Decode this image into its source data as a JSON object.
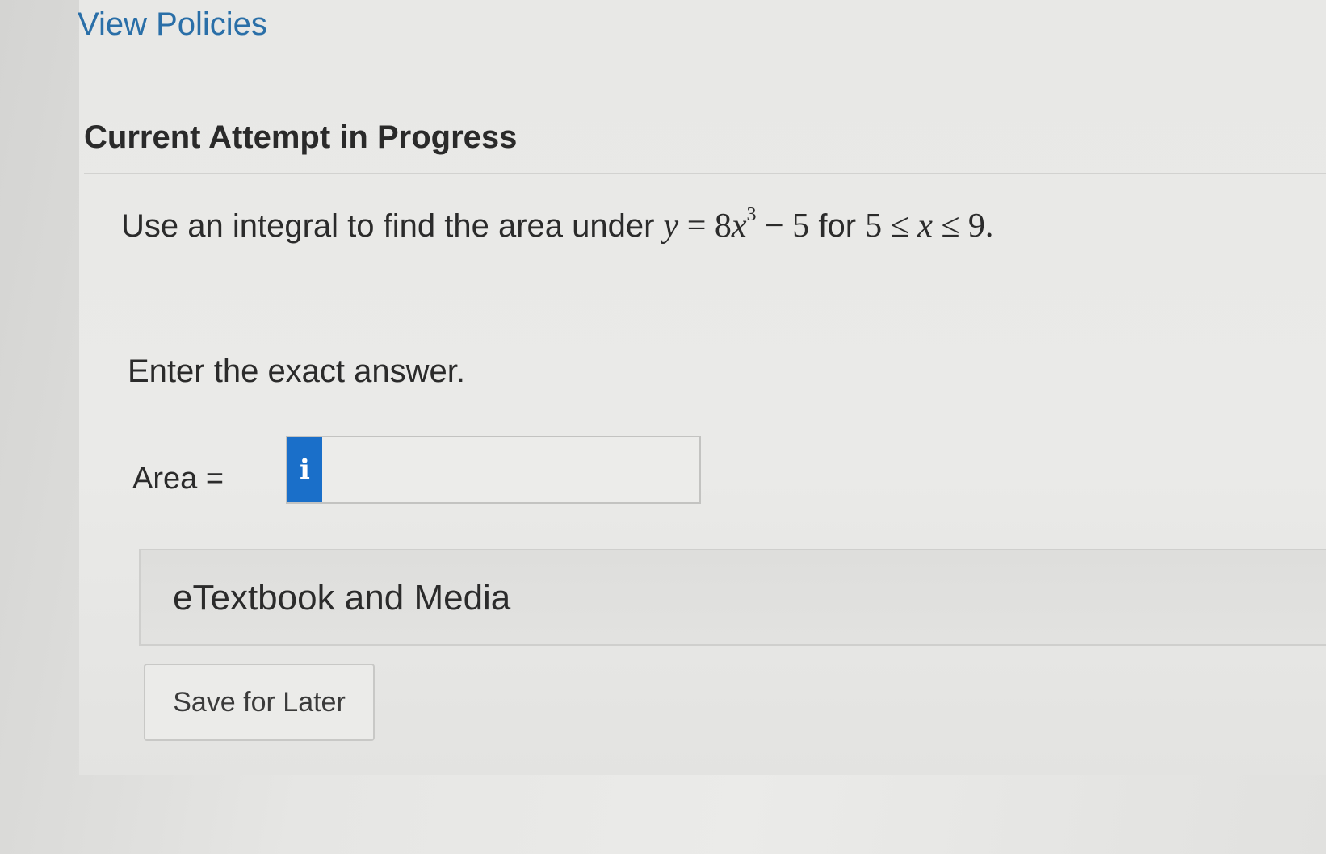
{
  "header": {
    "view_policies_link": "View Policies"
  },
  "attempt": {
    "title": "Current Attempt in Progress"
  },
  "question": {
    "prompt_prefix": "Use an integral to find the area under ",
    "var_y": "y",
    "eq": " = 8",
    "var_x": "x",
    "exponent": "3",
    "minus_const": " − 5",
    "for_word": " for ",
    "lower": "5 ≤ ",
    "var_x2": "x",
    "upper": " ≤ 9.",
    "instruction": "Enter the exact answer."
  },
  "answer": {
    "label": "Area  =",
    "info_icon": "i",
    "value": ""
  },
  "resources": {
    "etextbook_label": "eTextbook and Media"
  },
  "actions": {
    "save_label": "Save for Later"
  },
  "colors": {
    "link": "#2a6fa8",
    "info_button": "#1a6fc9",
    "background": "#e8e8e6"
  }
}
